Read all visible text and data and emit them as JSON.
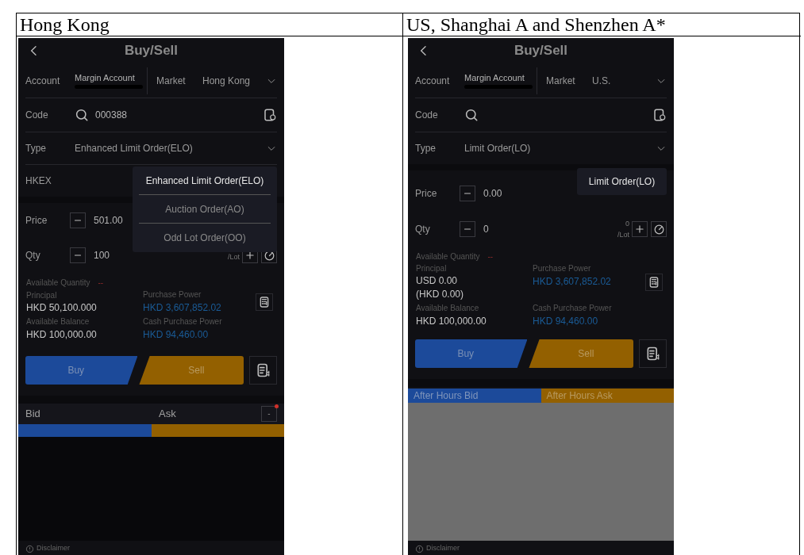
{
  "table": {
    "columns": [
      {
        "heading": "Hong Kong",
        "phone": {
          "title": "Buy/Sell",
          "account": {
            "label": "Account",
            "value": "Margin Account",
            "redacted": true
          },
          "market": {
            "label": "Market",
            "value": "Hong Kong"
          },
          "code": {
            "label": "Code",
            "value": "000388"
          },
          "type": {
            "label": "Type",
            "value": "Enhanced Limit Order(ELO)"
          },
          "exchange": "HKEX",
          "price": {
            "label": "Price",
            "value": "501.00"
          },
          "qty": {
            "label": "Qty",
            "value": "100",
            "lot_label": "/Lot"
          },
          "available_quantity": {
            "label": "Available Quantity",
            "value": "--"
          },
          "principal": {
            "label": "Principal",
            "lines": [
              "HKD 50,100.000"
            ]
          },
          "purchase_power": {
            "label": "Purchase Power",
            "value": "HKD 3,607,852.02"
          },
          "available_balance": {
            "label": "Available Balance",
            "value": "HKD 100,000.00"
          },
          "cash_purchase_power": {
            "label": "Cash Purchase Power",
            "value": "HKD 94,460.00"
          },
          "buy": "Buy",
          "sell": "Sell",
          "order_book": {
            "kind": "bid_ask",
            "bid": "Bid",
            "ask": "Ask",
            "level": 0.5,
            "toggle": "-",
            "alert": true
          },
          "dropdown": [
            {
              "label": "Enhanced Limit Order(ELO)",
              "selected": true
            },
            {
              "label": "Auction Order(AO)",
              "selected": false
            },
            {
              "label": "Odd Lot Order(OO)",
              "selected": false
            }
          ],
          "disclaimer": "Disclaimer"
        }
      },
      {
        "heading": "US, Shanghai A and Shenzhen A*",
        "phone": {
          "title": "Buy/Sell",
          "account": {
            "label": "Account",
            "value": "Margin Account",
            "redacted": true
          },
          "market": {
            "label": "Market",
            "value": "U.S."
          },
          "code": {
            "label": "Code"
          },
          "type": {
            "label": "Type",
            "value": "Limit Order(LO)"
          },
          "price": {
            "label": "Price",
            "value": "0.00"
          },
          "qty": {
            "label": "Qty",
            "value": "0",
            "lot_count": "0",
            "lot_label": "/Lot"
          },
          "available_quantity": {
            "label": "Available Quantity",
            "value": "--"
          },
          "principal": {
            "label": "Principal",
            "lines": [
              "USD 0.00",
              "(HKD 0.00)"
            ]
          },
          "purchase_power": {
            "label": "Purchase Power",
            "value": "HKD 3,607,852.02"
          },
          "available_balance": {
            "label": "Available Balance",
            "value": "HKD 100,000.00"
          },
          "cash_purchase_power": {
            "label": "Cash Purchase Power",
            "value": "HKD 94,460.00"
          },
          "buy": "Buy",
          "sell": "Sell",
          "order_book": {
            "kind": "after_hours",
            "bid": "After Hours Bid",
            "ask": "After Hours Ask"
          },
          "dropdown": [
            {
              "label": "Limit Order(LO)",
              "selected": true
            }
          ],
          "disclaimer": "Disclaimer"
        }
      }
    ]
  }
}
